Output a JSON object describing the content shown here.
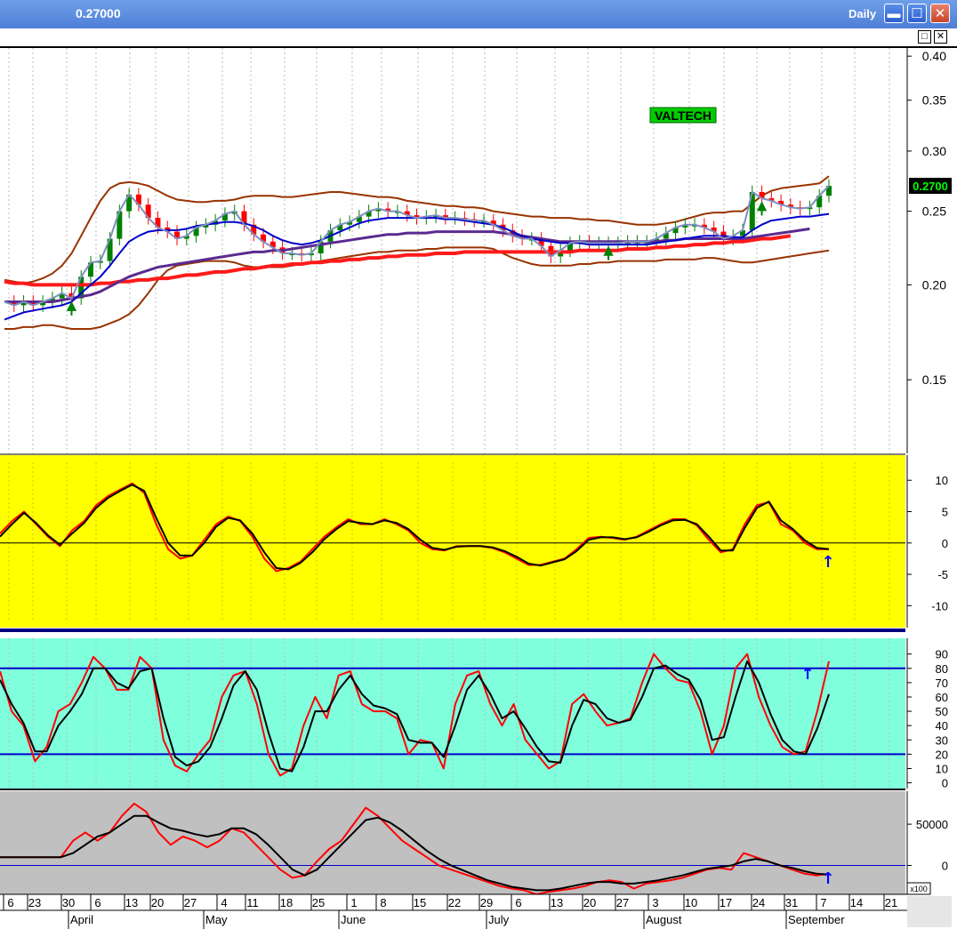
{
  "window": {
    "title": "0.27000",
    "period": "Daily",
    "minimize_icon": "minimize-icon",
    "maximize_icon": "maximize-icon",
    "close_icon": "close-icon"
  },
  "colors": {
    "price_bg": "#ffffff",
    "osc_bg": "#ffff00",
    "stoch_bg": "#80ffdd",
    "flow_bg": "#c0c0c0",
    "up_candle": "#008000",
    "down_candle": "#ff0000",
    "bollinger": "#993300",
    "ma_fast": "#0000cc",
    "ma_mid": "#5b2a8f",
    "ma_slow": "#ff1a1a",
    "price_line": "#7f8fbf",
    "signal_arrow": "#0000ff"
  },
  "chart_data": [
    {
      "type": "candlestick",
      "annotation": "VALTECH",
      "last_price_label": "0.2700",
      "y_ticks": [
        0.4,
        0.35,
        0.3,
        0.25,
        0.2,
        0.15
      ],
      "y_tick_labels": [
        "0.40",
        "0.35",
        "0.30",
        "0.25",
        "0.20",
        "0.15"
      ],
      "ylim": [
        0.12,
        0.41
      ],
      "y_scale": "log",
      "close": [
        0.19,
        0.188,
        0.19,
        0.188,
        0.19,
        0.192,
        0.195,
        0.192,
        0.205,
        0.214,
        0.215,
        0.23,
        0.25,
        0.263,
        0.255,
        0.245,
        0.238,
        0.235,
        0.23,
        0.232,
        0.238,
        0.24,
        0.243,
        0.248,
        0.25,
        0.24,
        0.233,
        0.228,
        0.224,
        0.22,
        0.22,
        0.219,
        0.22,
        0.228,
        0.236,
        0.24,
        0.242,
        0.246,
        0.25,
        0.252,
        0.25,
        0.25,
        0.247,
        0.245,
        0.246,
        0.247,
        0.245,
        0.245,
        0.244,
        0.243,
        0.243,
        0.24,
        0.236,
        0.232,
        0.23,
        0.23,
        0.225,
        0.218,
        0.222,
        0.227,
        0.228,
        0.227,
        0.227,
        0.227,
        0.227,
        0.228,
        0.228,
        0.228,
        0.23,
        0.234,
        0.238,
        0.24,
        0.24,
        0.238,
        0.235,
        0.23,
        0.232,
        0.236,
        0.265,
        0.26,
        0.258,
        0.255,
        0.253,
        0.252,
        0.253,
        0.262,
        0.27
      ],
      "bollinger_upper": [
        0.203,
        0.202,
        0.201,
        0.202,
        0.204,
        0.207,
        0.212,
        0.22,
        0.232,
        0.245,
        0.258,
        0.268,
        0.272,
        0.273,
        0.272,
        0.27,
        0.266,
        0.262,
        0.259,
        0.258,
        0.257,
        0.257,
        0.258,
        0.258,
        0.259,
        0.261,
        0.262,
        0.262,
        0.262,
        0.261,
        0.261,
        0.262,
        0.263,
        0.264,
        0.265,
        0.265,
        0.264,
        0.263,
        0.262,
        0.261,
        0.261,
        0.26,
        0.258,
        0.257,
        0.256,
        0.255,
        0.254,
        0.254,
        0.253,
        0.253,
        0.252,
        0.25,
        0.249,
        0.248,
        0.247,
        0.246,
        0.246,
        0.245,
        0.245,
        0.245,
        0.244,
        0.244,
        0.243,
        0.243,
        0.242,
        0.241,
        0.24,
        0.24,
        0.24,
        0.241,
        0.242,
        0.244,
        0.246,
        0.248,
        0.249,
        0.249,
        0.25,
        0.25,
        0.256,
        0.262,
        0.266,
        0.268,
        0.269,
        0.27,
        0.271,
        0.272,
        0.278
      ],
      "bollinger_lower": [
        0.175,
        0.175,
        0.176,
        0.176,
        0.177,
        0.177,
        0.176,
        0.175,
        0.175,
        0.175,
        0.176,
        0.178,
        0.18,
        0.183,
        0.188,
        0.195,
        0.203,
        0.209,
        0.212,
        0.213,
        0.214,
        0.215,
        0.215,
        0.215,
        0.214,
        0.212,
        0.211,
        0.211,
        0.211,
        0.211,
        0.212,
        0.213,
        0.214,
        0.215,
        0.216,
        0.217,
        0.218,
        0.219,
        0.22,
        0.221,
        0.221,
        0.222,
        0.222,
        0.222,
        0.223,
        0.223,
        0.224,
        0.224,
        0.224,
        0.224,
        0.224,
        0.223,
        0.22,
        0.217,
        0.215,
        0.213,
        0.212,
        0.212,
        0.212,
        0.212,
        0.213,
        0.213,
        0.214,
        0.214,
        0.215,
        0.215,
        0.215,
        0.215,
        0.215,
        0.216,
        0.216,
        0.216,
        0.216,
        0.217,
        0.217,
        0.216,
        0.215,
        0.214,
        0.214,
        0.215,
        0.216,
        0.217,
        0.218,
        0.219,
        0.22,
        0.221,
        0.222
      ],
      "ma_fast": [
        0.18,
        0.182,
        0.184,
        0.185,
        0.186,
        0.187,
        0.188,
        0.19,
        0.195,
        0.2,
        0.205,
        0.212,
        0.22,
        0.228,
        0.232,
        0.235,
        0.236,
        0.236,
        0.236,
        0.237,
        0.239,
        0.24,
        0.241,
        0.242,
        0.242,
        0.241,
        0.239,
        0.236,
        0.232,
        0.229,
        0.227,
        0.226,
        0.227,
        0.229,
        0.232,
        0.235,
        0.238,
        0.241,
        0.243,
        0.244,
        0.245,
        0.245,
        0.245,
        0.245,
        0.245,
        0.245,
        0.244,
        0.244,
        0.243,
        0.242,
        0.241,
        0.24,
        0.238,
        0.235,
        0.232,
        0.23,
        0.229,
        0.228,
        0.227,
        0.227,
        0.227,
        0.226,
        0.226,
        0.226,
        0.226,
        0.226,
        0.226,
        0.226,
        0.227,
        0.228,
        0.229,
        0.23,
        0.231,
        0.232,
        0.232,
        0.232,
        0.231,
        0.231,
        0.236,
        0.24,
        0.243,
        0.244,
        0.245,
        0.246,
        0.246,
        0.247,
        0.248
      ],
      "ma_mid": [
        0.19,
        0.19,
        0.19,
        0.19,
        0.19,
        0.19,
        0.191,
        0.192,
        0.193,
        0.194,
        0.196,
        0.199,
        0.202,
        0.205,
        0.207,
        0.209,
        0.211,
        0.212,
        0.213,
        0.214,
        0.215,
        0.216,
        0.217,
        0.218,
        0.219,
        0.22,
        0.221,
        0.221,
        0.222,
        0.222,
        0.223,
        0.224,
        0.225,
        0.226,
        0.227,
        0.228,
        0.229,
        0.23,
        0.231,
        0.232,
        0.233,
        0.233,
        0.234,
        0.234,
        0.234,
        0.235,
        0.235,
        0.235,
        0.235,
        0.235,
        0.235,
        0.235,
        0.234,
        0.233,
        0.232,
        0.231,
        0.23,
        0.229,
        0.228,
        0.228,
        0.228,
        0.228,
        0.228,
        0.228,
        0.228,
        0.228,
        0.228,
        0.228,
        0.228,
        0.229,
        0.229,
        0.23,
        0.23,
        0.23,
        0.23,
        0.23,
        0.23,
        0.23,
        0.231,
        0.232,
        0.233,
        0.234,
        0.235,
        0.236,
        0.237,
        null,
        null
      ],
      "ma_slow": [
        0.202,
        0.201,
        0.201,
        0.2,
        0.2,
        0.2,
        0.2,
        0.2,
        0.2,
        0.2,
        0.201,
        0.201,
        0.202,
        0.202,
        0.203,
        0.203,
        0.204,
        0.204,
        0.205,
        0.206,
        0.206,
        0.207,
        0.208,
        0.208,
        0.209,
        0.21,
        0.21,
        0.211,
        0.212,
        0.212,
        0.213,
        0.213,
        0.214,
        0.214,
        0.215,
        0.215,
        0.216,
        0.216,
        0.217,
        0.217,
        0.218,
        0.218,
        0.219,
        0.219,
        0.219,
        0.22,
        0.22,
        0.22,
        0.221,
        0.221,
        0.221,
        0.221,
        0.221,
        0.221,
        0.221,
        0.221,
        0.221,
        0.221,
        0.221,
        0.221,
        0.222,
        0.222,
        0.222,
        0.222,
        0.222,
        0.223,
        0.223,
        0.223,
        0.224,
        0.224,
        0.225,
        0.225,
        0.226,
        0.226,
        0.227,
        0.227,
        0.228,
        0.228,
        0.229,
        0.23,
        0.23,
        0.231,
        0.232,
        null,
        null,
        null,
        null
      ],
      "up_signal_indices": [
        7,
        63,
        79
      ]
    },
    {
      "type": "line",
      "y_ticks": [
        10,
        5,
        0,
        -5,
        -10
      ],
      "y_tick_labels": [
        "10",
        "5",
        "0",
        "-5",
        "-10"
      ],
      "ylim": [
        -13.5,
        14
      ],
      "series": [
        {
          "color": "#ff0000",
          "values": [
            1.5,
            3.5,
            5,
            3,
            1,
            -0.5,
            2,
            3.5,
            6,
            7.5,
            8.5,
            9.5,
            8,
            3,
            -1,
            -2.5,
            -2,
            0.5,
            3,
            4.2,
            3.5,
            1,
            -2.5,
            -4.5,
            -4,
            -3,
            -1,
            1,
            2.5,
            3.8,
            3,
            3,
            3.8,
            3,
            2,
            0,
            -1,
            -1.2,
            -0.5,
            -0.5,
            -0.5,
            -0.8,
            -1.5,
            -2.5,
            -3.5,
            -3.5,
            -3,
            -2.5,
            -1,
            0.8,
            1,
            0.8,
            0.5,
            1,
            2,
            3,
            3.8,
            3.8,
            2.8,
            0.5,
            -1.5,
            -1,
            3,
            6,
            6.5,
            3,
            2,
            0,
            -1,
            -1
          ]
        },
        {
          "color": "#000000",
          "values": [
            1,
            3,
            4.8,
            3.2,
            1.2,
            -0.3,
            1.5,
            3.2,
            5.6,
            7.2,
            8.3,
            9.3,
            8.3,
            4,
            0,
            -2,
            -2,
            0,
            2.6,
            4,
            3.6,
            1.5,
            -1.5,
            -4,
            -4.2,
            -3.2,
            -1.5,
            0.6,
            2.2,
            3.5,
            3.2,
            3,
            3.6,
            3.2,
            2.2,
            0.5,
            -0.8,
            -1.1,
            -0.6,
            -0.5,
            -0.5,
            -0.7,
            -1.3,
            -2.2,
            -3.3,
            -3.6,
            -3.1,
            -2.6,
            -1.3,
            0.5,
            0.9,
            0.9,
            0.6,
            0.9,
            1.8,
            2.8,
            3.6,
            3.7,
            3,
            1,
            -1.2,
            -1.2,
            2.4,
            5.6,
            6.6,
            3.6,
            2.2,
            0.4,
            -0.8,
            -1
          ]
        }
      ],
      "signal_arrow_label": "↑"
    },
    {
      "type": "line",
      "y_ticks": [
        90,
        80,
        70,
        60,
        50,
        40,
        30,
        20,
        10,
        0
      ],
      "y_tick_labels": [
        "90",
        "80",
        "70",
        "60",
        "50",
        "40",
        "30",
        "20",
        "10",
        "0"
      ],
      "ylim": [
        -4,
        101
      ],
      "reference_lines": [
        80,
        20
      ],
      "series": [
        {
          "color": "#ff0000",
          "values": [
            78,
            50,
            40,
            15,
            25,
            50,
            55,
            70,
            88,
            80,
            65,
            65,
            88,
            80,
            30,
            12,
            8,
            20,
            30,
            60,
            75,
            78,
            55,
            20,
            5,
            10,
            40,
            60,
            45,
            75,
            78,
            55,
            50,
            50,
            45,
            20,
            30,
            28,
            10,
            55,
            75,
            78,
            55,
            40,
            55,
            30,
            20,
            10,
            15,
            55,
            62,
            50,
            40,
            42,
            45,
            70,
            90,
            80,
            72,
            70,
            50,
            20,
            40,
            80,
            90,
            60,
            40,
            25,
            20,
            22,
            50,
            85
          ]
        },
        {
          "color": "#000000",
          "values": [
            72,
            55,
            42,
            22,
            22,
            40,
            50,
            62,
            80,
            80,
            70,
            66,
            78,
            80,
            45,
            18,
            12,
            15,
            25,
            45,
            68,
            78,
            65,
            35,
            10,
            8,
            25,
            50,
            50,
            65,
            75,
            62,
            54,
            52,
            48,
            30,
            28,
            28,
            18,
            40,
            65,
            75,
            62,
            45,
            50,
            38,
            25,
            15,
            14,
            40,
            58,
            55,
            45,
            42,
            44,
            60,
            80,
            82,
            76,
            72,
            58,
            30,
            32,
            60,
            85,
            70,
            48,
            30,
            22,
            20,
            38,
            62
          ]
        }
      ],
      "signal_arrow_label": "↑"
    },
    {
      "type": "line",
      "y_ticks": [
        50000,
        0
      ],
      "y_tick_labels": [
        "50000",
        "0"
      ],
      "ylim": [
        -35000,
        90000
      ],
      "unit_label": "x100",
      "series": [
        {
          "color": "#ff0000",
          "values": [
            10000,
            10000,
            10000,
            10000,
            10000,
            10000,
            30000,
            40000,
            30000,
            40000,
            60000,
            75000,
            65000,
            40000,
            25000,
            35000,
            30000,
            22000,
            30000,
            45000,
            40000,
            25000,
            10000,
            -5000,
            -15000,
            -12000,
            5000,
            20000,
            30000,
            50000,
            70000,
            60000,
            45000,
            30000,
            20000,
            10000,
            0,
            -5000,
            -10000,
            -15000,
            -20000,
            -25000,
            -28000,
            -30000,
            -35000,
            -32000,
            -30000,
            -28000,
            -25000,
            -20000,
            -18000,
            -20000,
            -28000,
            -22000,
            -20000,
            -18000,
            -15000,
            -10000,
            -5000,
            -3000,
            -5000,
            15000,
            10000,
            5000,
            0,
            -5000,
            -10000,
            -12000,
            -10000
          ]
        },
        {
          "color": "#000000",
          "values": [
            10000,
            10000,
            10000,
            10000,
            10000,
            10000,
            15000,
            25000,
            35000,
            40000,
            50000,
            60000,
            60000,
            52000,
            45000,
            42000,
            38000,
            35000,
            38000,
            45000,
            45000,
            38000,
            25000,
            10000,
            -5000,
            -12000,
            -5000,
            10000,
            25000,
            40000,
            55000,
            58000,
            52000,
            42000,
            30000,
            18000,
            8000,
            0,
            -6000,
            -12000,
            -18000,
            -22000,
            -26000,
            -28000,
            -30000,
            -30000,
            -28000,
            -25000,
            -22000,
            -20000,
            -20000,
            -22000,
            -22000,
            -20000,
            -18000,
            -15000,
            -12000,
            -8000,
            -4000,
            -2000,
            0,
            5000,
            8000,
            5000,
            0,
            -3000,
            -7000,
            -10000,
            -11000
          ]
        }
      ],
      "signal_arrow_label": "↑"
    }
  ],
  "x_axis": {
    "day_labels": [
      "6",
      "23",
      "30",
      "6",
      "13",
      "20",
      "27",
      "4",
      "11",
      "18",
      "25",
      "1",
      "8",
      "15",
      "22",
      "29",
      "6",
      "13",
      "20",
      "27",
      "3",
      "10",
      "17",
      "24",
      "31",
      "7",
      "14",
      "21"
    ],
    "month_labels": [
      "April",
      "May",
      "June",
      "July",
      "August",
      "September"
    ]
  }
}
